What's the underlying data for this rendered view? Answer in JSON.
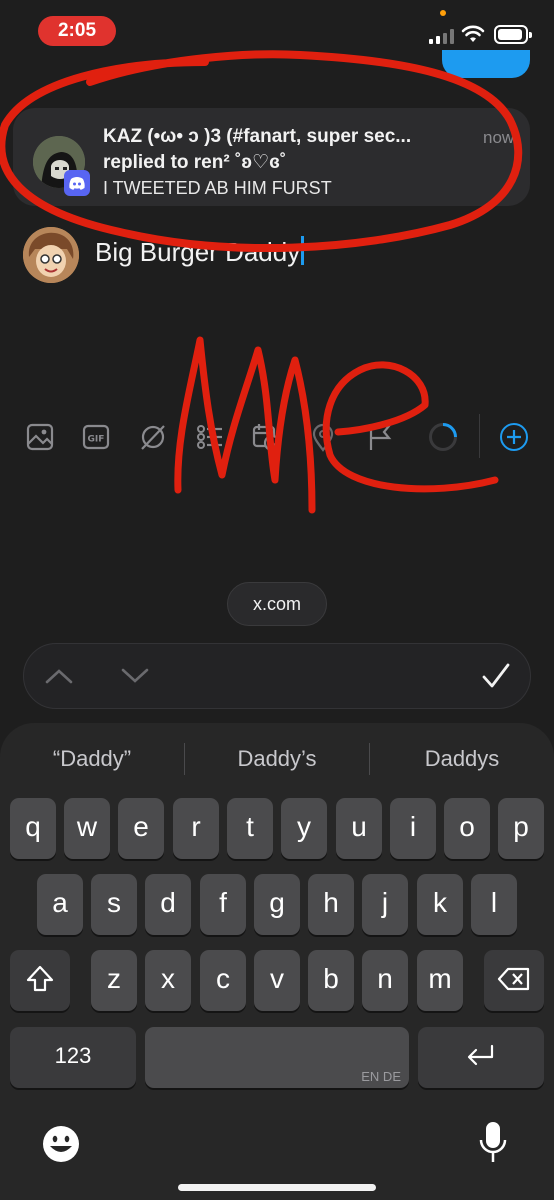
{
  "status_bar": {
    "time": "2:05"
  },
  "notification": {
    "title": "KAZ (•ω• ↄ  )3 (#fanart, super sec...",
    "subtitle": "replied to ren²  ˚ʚ♡ɞ˚",
    "body": "I TWEETED AB HIM FURST",
    "time": "now",
    "app_icon": "discord-icon"
  },
  "compose": {
    "text": "Big Burger Daddy"
  },
  "toolbar": {
    "icons": [
      "image-icon",
      "gif-icon",
      "grok-icon",
      "poll-icon",
      "schedule-icon",
      "location-icon",
      "flag-icon",
      "character-count-ring",
      "add-post-icon"
    ]
  },
  "url_bar": {
    "domain": "x.com"
  },
  "find_bar": {
    "icons": [
      "chevron-up-icon",
      "chevron-down-icon",
      "checkmark-icon"
    ]
  },
  "keyboard": {
    "suggestions": [
      "“Daddy”",
      "Daddy’s",
      "Daddys"
    ],
    "row1": [
      "q",
      "w",
      "e",
      "r",
      "t",
      "y",
      "u",
      "i",
      "o",
      "p"
    ],
    "row2": [
      "a",
      "s",
      "d",
      "f",
      "g",
      "h",
      "j",
      "k",
      "l"
    ],
    "row3": [
      "z",
      "x",
      "c",
      "v",
      "b",
      "n",
      "m"
    ],
    "numbers_label": "123",
    "language_label": "EN DE",
    "icons": [
      "shift-icon",
      "delete-icon",
      "return-icon",
      "emoji-icon",
      "microphone-icon"
    ]
  },
  "annotation": {
    "text": "Me",
    "color": "#e0200f"
  }
}
